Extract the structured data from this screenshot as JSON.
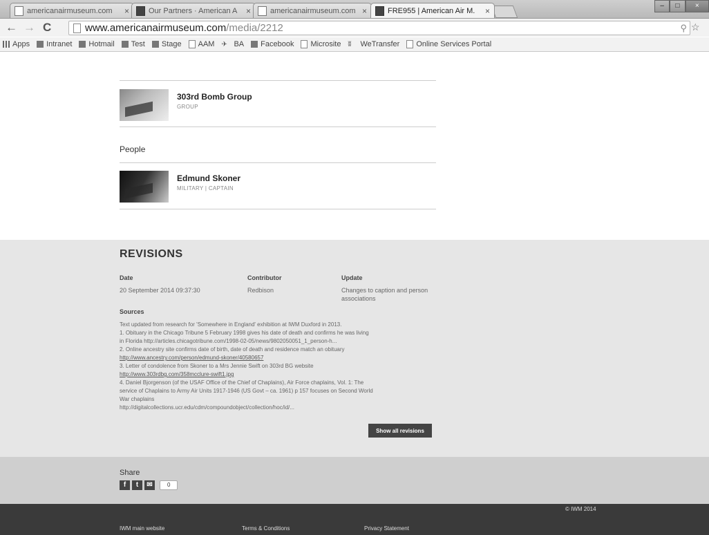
{
  "browser": {
    "tabs": [
      {
        "label": "americanairmuseum.com",
        "icon": "page-icon"
      },
      {
        "label": "Our Partners · American A",
        "icon": "iwm-icon"
      },
      {
        "label": "americanairmuseum.com",
        "icon": "page-icon"
      },
      {
        "label": "FRE955 | American Air M.",
        "icon": "iwm-icon",
        "active": true
      }
    ],
    "url_host": "www.americanairmuseum.com",
    "url_path": "/media/2212",
    "bookmarks": [
      {
        "label": "Apps",
        "icon": "grid-icon"
      },
      {
        "label": "Intranet",
        "icon": "folder-icon"
      },
      {
        "label": "Hotmail",
        "icon": "windows-icon"
      },
      {
        "label": "Test",
        "icon": "iwm-icon"
      },
      {
        "label": "Stage",
        "icon": "iwm-icon"
      },
      {
        "label": "AAM",
        "icon": "page-icon"
      },
      {
        "label": "BA",
        "icon": "plane-icon"
      },
      {
        "label": "Facebook",
        "icon": "facebook-icon"
      },
      {
        "label": "Microsite",
        "icon": "page-icon"
      },
      {
        "label": "WeTransfer",
        "icon": "wetransfer-icon"
      },
      {
        "label": "Online Services Portal",
        "icon": "page-icon"
      }
    ]
  },
  "groups": {
    "items": [
      {
        "name": "303rd Bomb Group",
        "type": "GROUP"
      }
    ]
  },
  "people": {
    "heading": "People",
    "items": [
      {
        "name": "Edmund Skoner",
        "type": "MILITARY | CAPTAIN"
      }
    ]
  },
  "revisions": {
    "title": "REVISIONS",
    "col_date": "Date",
    "col_contributor": "Contributor",
    "col_update": "Update",
    "row": {
      "date": "20 September 2014 09:37:30",
      "contributor": "Redbison",
      "update": "Changes to caption and person associations"
    },
    "sources_heading": "Sources",
    "sources": [
      "Text updated from research for 'Somewhere in England' exhibition at IWM Duxford in 2013.",
      "1. Obituary in the Chicago Tribune 5 February 1998 gives his date of death and confirms he was living",
      "in Florida http://articles.chicagotribune.com/1998-02-05/news/9802050051_1_person-h...",
      "2. Online ancestry site confirms date of birth, date of death and residence match an obituary",
      "http://www.ancestry.com/person/edmund-skoner/40580657",
      "3. Letter of condolence from Skoner to a Mrs Jennie Swift on 303rd BG website",
      "http://www.303rdbg.com/358mcclure-swift1.jpg",
      "4. Daniel Bjorgenson (of the USAF Office of the Chief of Chaplains), Air Force chaplains, Vol. 1: The",
      "service of Chaplains to Army Air Units 1917-1946 (US Govt – ca. 1961) p 157 focuses on Second World",
      "War chaplains",
      "http://digitalcollections.ucr.edu/cdm/compoundobject/collection/hoc/id/..."
    ],
    "show_all_label": "Show all revisions"
  },
  "share": {
    "heading": "Share",
    "icons": [
      "facebook-icon",
      "twitter-icon",
      "email-icon"
    ],
    "count": "0"
  },
  "footer": {
    "links": [
      "IWM main website",
      "Terms & Conditions",
      "Privacy Statement"
    ],
    "copyright": "© IWM 2014"
  }
}
